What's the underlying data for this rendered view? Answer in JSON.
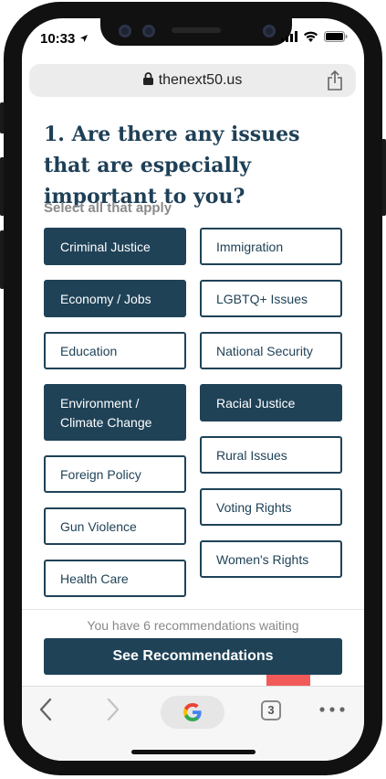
{
  "status_bar": {
    "time": "10:33"
  },
  "browser": {
    "url": "thenext50.us",
    "tab_count": "3"
  },
  "question": "1. Are there any issues that are especially important to you?",
  "hint": "Select all that apply",
  "issues_left": [
    {
      "label": "Criminal Justice",
      "selected": true
    },
    {
      "label": "Economy / Jobs",
      "selected": true
    },
    {
      "label": "Education",
      "selected": false
    },
    {
      "label": "Environment / Climate Change",
      "selected": true
    },
    {
      "label": "Foreign Policy",
      "selected": false
    },
    {
      "label": "Gun Violence",
      "selected": false
    },
    {
      "label": "Health Care",
      "selected": false
    }
  ],
  "issues_right": [
    {
      "label": "Immigration",
      "selected": false
    },
    {
      "label": "LGBTQ+ Issues",
      "selected": false
    },
    {
      "label": "National Security",
      "selected": false
    },
    {
      "label": "Racial Justice",
      "selected": true
    },
    {
      "label": "Rural Issues",
      "selected": false
    },
    {
      "label": "Voting Rights",
      "selected": false
    },
    {
      "label": "Women's Rights",
      "selected": false
    }
  ],
  "footer": {
    "waiting_text": "You have 6 recommendations waiting",
    "cta_label": "See Recommendations"
  },
  "colors": {
    "primary": "#1f4257",
    "accent_red": "#f25a5a"
  }
}
